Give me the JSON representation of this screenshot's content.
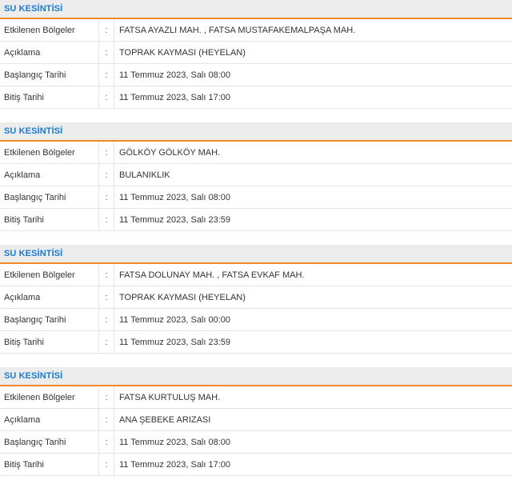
{
  "outages": [
    {
      "title": "SU KESİNTİSİ",
      "rows": [
        {
          "label": "Etkilenen Bölgeler",
          "sep": ":",
          "value": "FATSA AYAZLI MAH. , FATSA MUSTAFAKEMALPAŞA MAH."
        },
        {
          "label": "Açıklama",
          "sep": ":",
          "value": "TOPRAK KAYMASI (HEYELAN)"
        },
        {
          "label": "Başlangıç Tarihi",
          "sep": ":",
          "value": "11 Temmuz 2023, Salı 08:00"
        },
        {
          "label": "Bitiş Tarihi",
          "sep": ":",
          "value": "11 Temmuz 2023, Salı 17:00"
        }
      ]
    },
    {
      "title": "SU KESİNTİSİ",
      "rows": [
        {
          "label": "Etkilenen Bölgeler",
          "sep": ":",
          "value": "GÖLKÖY GÖLKÖY MAH."
        },
        {
          "label": "Açıklama",
          "sep": ":",
          "value": "BULANIKLIK"
        },
        {
          "label": "Başlangıç Tarihi",
          "sep": ":",
          "value": "11 Temmuz 2023, Salı 08:00"
        },
        {
          "label": "Bitiş Tarihi",
          "sep": ":",
          "value": "11 Temmuz 2023, Salı 23:59"
        }
      ]
    },
    {
      "title": "SU KESİNTİSİ",
      "rows": [
        {
          "label": "Etkilenen Bölgeler",
          "sep": ":",
          "value": "FATSA DOLUNAY MAH. , FATSA EVKAF MAH."
        },
        {
          "label": "Açıklama",
          "sep": ":",
          "value": "TOPRAK KAYMASI (HEYELAN)"
        },
        {
          "label": "Başlangıç Tarihi",
          "sep": ":",
          "value": "11 Temmuz 2023, Salı 00:00"
        },
        {
          "label": "Bitiş Tarihi",
          "sep": ":",
          "value": "11 Temmuz 2023, Salı 23:59"
        }
      ]
    },
    {
      "title": "SU KESİNTİSİ",
      "rows": [
        {
          "label": "Etkilenen Bölgeler",
          "sep": ":",
          "value": "FATSA KURTULUŞ MAH."
        },
        {
          "label": "Açıklama",
          "sep": ":",
          "value": "ANA ŞEBEKE ARIZASI"
        },
        {
          "label": "Başlangıç Tarihi",
          "sep": ":",
          "value": "11 Temmuz 2023, Salı 08:00"
        },
        {
          "label": "Bitiş Tarihi",
          "sep": ":",
          "value": "11 Temmuz 2023, Salı 17:00"
        }
      ]
    }
  ],
  "colors": {
    "title": "#1a7bd0",
    "accent": "#f08a24",
    "header_bg": "#ececec"
  }
}
